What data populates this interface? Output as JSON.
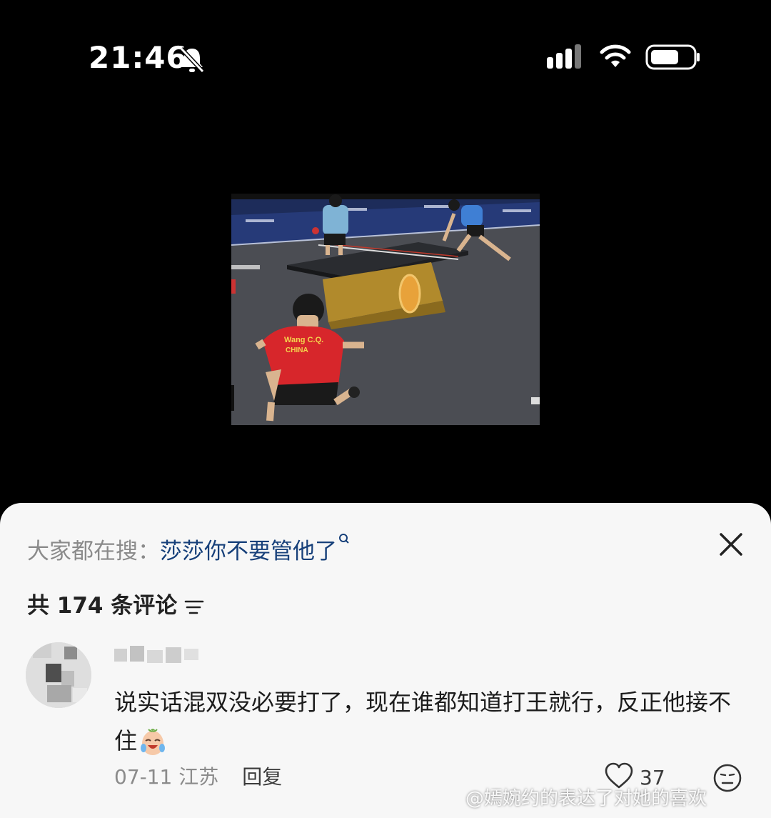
{
  "status_bar": {
    "time": "21:46",
    "icons": [
      "bell-muted-icon",
      "signal-icon",
      "wifi-icon",
      "battery-icon"
    ]
  },
  "video": {
    "jersey_text": "Wang C.Q.",
    "jersey_country": "CHINA",
    "description": "table tennis match frame"
  },
  "sheet": {
    "search_prefix": "大家都在搜：",
    "search_term": "莎莎你不要管他了",
    "comment_count_label": "共 174 条评论"
  },
  "comment": {
    "text": "说实话混双没必要打了，现在谁都知道打王就行，反正他接不住",
    "date": "07-11",
    "location": "江苏",
    "reply_label": "回复",
    "likes": "37"
  },
  "watermark": "@嫣婉约的表达了对她的喜欢",
  "colors": {
    "accent_link": "#17407a",
    "sheet_bg": "#f7f7f7",
    "muted_text": "#8a8a8a"
  }
}
